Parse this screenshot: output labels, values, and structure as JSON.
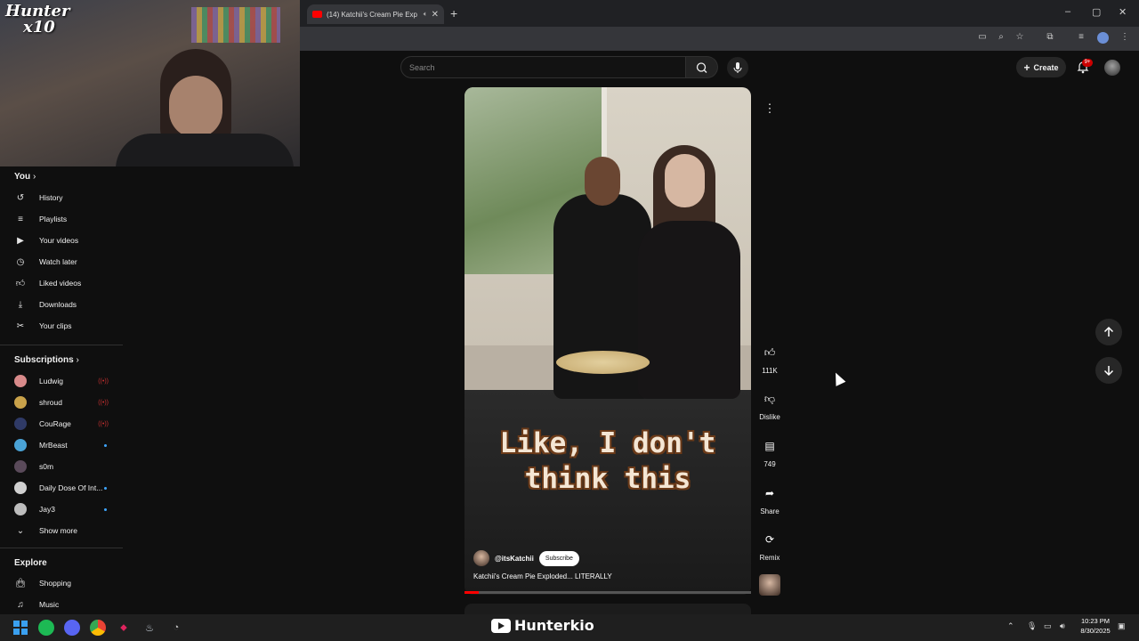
{
  "browser": {
    "tab_title": "(14) Katchii's Cream Pie Exp",
    "new_tab": "+",
    "win_min": "–",
    "win_max": "▢",
    "win_close": "✕"
  },
  "webcam": {
    "logo_line1": "Hunter",
    "logo_line2": "x10"
  },
  "header": {
    "search_placeholder": "Search",
    "create_label": "Create",
    "notif_badge": "9+"
  },
  "sidebar": {
    "you_label": "You",
    "you_items": [
      {
        "label": "History",
        "icon": "history-icon"
      },
      {
        "label": "Playlists",
        "icon": "playlists-icon"
      },
      {
        "label": "Your videos",
        "icon": "your-videos-icon"
      },
      {
        "label": "Watch later",
        "icon": "watch-later-icon"
      },
      {
        "label": "Liked videos",
        "icon": "thumb-up-icon"
      },
      {
        "label": "Downloads",
        "icon": "download-icon"
      },
      {
        "label": "Your clips",
        "icon": "scissors-icon"
      }
    ],
    "subscriptions_label": "Subscriptions",
    "subscriptions": [
      {
        "name": "Ludwig",
        "indicator": "live",
        "color": "#d88a8a"
      },
      {
        "name": "shroud",
        "indicator": "live",
        "color": "#c9a24a"
      },
      {
        "name": "CouRage",
        "indicator": "live",
        "color": "#2f3a66"
      },
      {
        "name": "MrBeast",
        "indicator": "dot",
        "color": "#4aa3d6"
      },
      {
        "name": "s0m",
        "indicator": "none",
        "color": "#5a4a5a"
      },
      {
        "name": "Daily Dose Of Int...",
        "indicator": "dot",
        "color": "#d0d0d0"
      },
      {
        "name": "Jay3",
        "indicator": "dot",
        "color": "#bdbdbd"
      }
    ],
    "show_more": "Show more",
    "explore_label": "Explore",
    "explore_items": [
      {
        "label": "Shopping",
        "icon": "shopping-bag-icon"
      },
      {
        "label": "Music",
        "icon": "music-note-icon"
      }
    ]
  },
  "short": {
    "caption_line1": "Like, I don't",
    "caption_line2": "think this",
    "channel_handle": "@itsKatchii",
    "subscribe_label": "Subscribe",
    "title": "Katchii's Cream Pie Exploded... LITERALLY",
    "progress_fraction": 0.05
  },
  "actions": {
    "likes": "111K",
    "dislike_label": "Dislike",
    "comments": "749",
    "share_label": "Share",
    "remix_label": "Remix"
  },
  "taskbar": {
    "watermark": "Hunterkio",
    "time": "10:23 PM",
    "date": "8/30/2025"
  }
}
